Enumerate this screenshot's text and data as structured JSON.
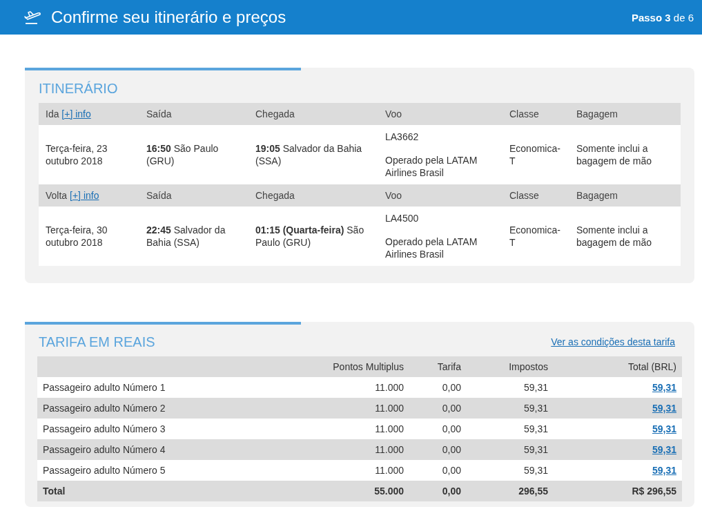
{
  "header": {
    "title": "Confirme seu itinerário e preços",
    "step": "**Passo 3** de 6"
  },
  "itinerary": {
    "title": "ITINERÁRIO",
    "legs": [
      {
        "label": "Ida",
        "info_link": "[+] info",
        "columns": [
          "Saída",
          "Chegada",
          "Voo",
          "Classe",
          "Bagagem"
        ],
        "date": "Terça-feira, 23 outubro 2018",
        "departure": "**16:50** São Paulo (GRU)",
        "arrival": "**19:05** Salvador da Bahia (SSA)",
        "flight": "LA3662",
        "operator": "Operado pela LATAM Airlines Brasil",
        "class": "Economica-T",
        "baggage": "Somente inclui a bagagem de mão"
      },
      {
        "label": "Volta",
        "info_link": "[+] info",
        "columns": [
          "Saída",
          "Chegada",
          "Voo",
          "Classe",
          "Bagagem"
        ],
        "date": "Terça-feira, 30 outubro 2018",
        "departure": "**22:45** Salvador da Bahia (SSA)",
        "arrival": "**01:15 (Quarta-feira)** São Paulo (GRU)",
        "flight": "LA4500",
        "operator": "Operado pela LATAM Airlines Brasil",
        "class": "Economica-T",
        "baggage": "Somente inclui a bagagem de mão"
      }
    ]
  },
  "fare": {
    "title": "TARIFA EM REAIS",
    "conditions_link": "Ver as condições desta tarifa",
    "columns": [
      "Pontos Multiplus",
      "Tarifa",
      "Impostos",
      "Total (BRL)"
    ],
    "rows": [
      {
        "passenger": "Passageiro adulto Número 1",
        "points": "11.000",
        "fare": "0,00",
        "taxes": "59,31",
        "total": "59,31"
      },
      {
        "passenger": "Passageiro adulto Número 2",
        "points": "11.000",
        "fare": "0,00",
        "taxes": "59,31",
        "total": "59,31"
      },
      {
        "passenger": "Passageiro adulto Número 3",
        "points": "11.000",
        "fare": "0,00",
        "taxes": "59,31",
        "total": "59,31"
      },
      {
        "passenger": "Passageiro adulto Número 4",
        "points": "11.000",
        "fare": "0,00",
        "taxes": "59,31",
        "total": "59,31"
      },
      {
        "passenger": "Passageiro adulto Número 5",
        "points": "11.000",
        "fare": "0,00",
        "taxes": "59,31",
        "total": "59,31"
      }
    ],
    "total": {
      "label": "Total",
      "points": "55.000",
      "fare": "0,00",
      "taxes": "296,55",
      "total": "R$ 296,55"
    }
  }
}
